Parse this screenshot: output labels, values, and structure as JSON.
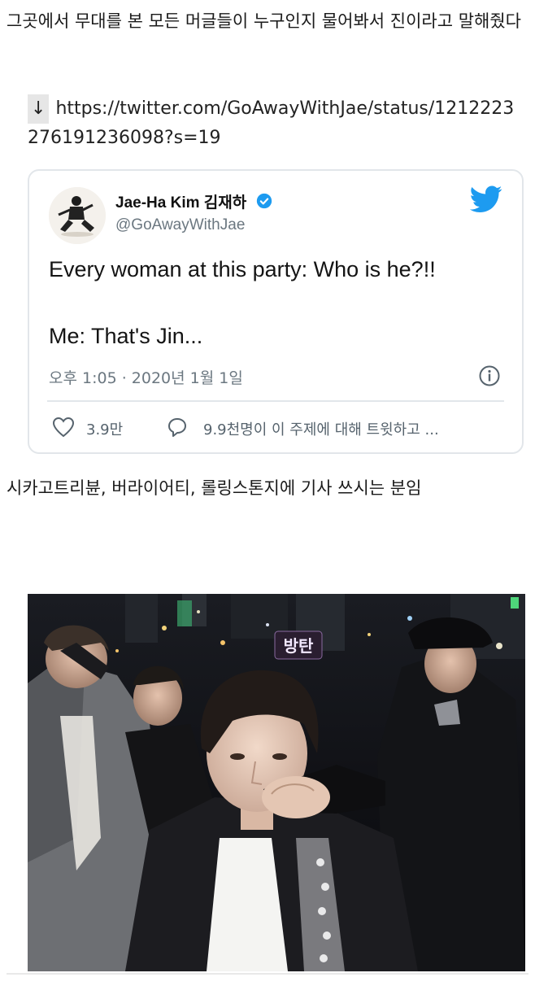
{
  "post": {
    "intro_text": "그곳에서 무대를 본 모든 머글들이 누구인지 물어봐서 진이라고 말해줬다",
    "link_arrow": "↓",
    "link_url": "https://twitter.com/GoAwayWithJae/status/1212223276191236098?s=19",
    "caption_text": "시카고트리뷴, 버라이어티, 롤링스톤지에 기사 쓰시는 분임"
  },
  "tweet": {
    "author_name": "Jae-Ha Kim 김재하",
    "handle": "@GoAwayWithJae",
    "line_1": "Every woman at this party: Who is he?!!",
    "line_2": "Me: That's Jin...",
    "timestamp": "오후 1:05 · 2020년 1월 1일",
    "like_count": "3.9만",
    "talking_text": "9.9천명이 이 주제에 대해 트윗하고 ..."
  },
  "photo": {
    "sign_text": "방탄"
  },
  "icons": {
    "verified": "verified-badge-icon",
    "bird": "twitter-bird-icon",
    "info": "info-icon",
    "heart": "heart-icon",
    "reply": "reply-bubble-icon"
  },
  "colors": {
    "twitter_blue": "#1d9bf0",
    "muted_text": "#6b7780",
    "card_border": "#e2e6ea"
  }
}
